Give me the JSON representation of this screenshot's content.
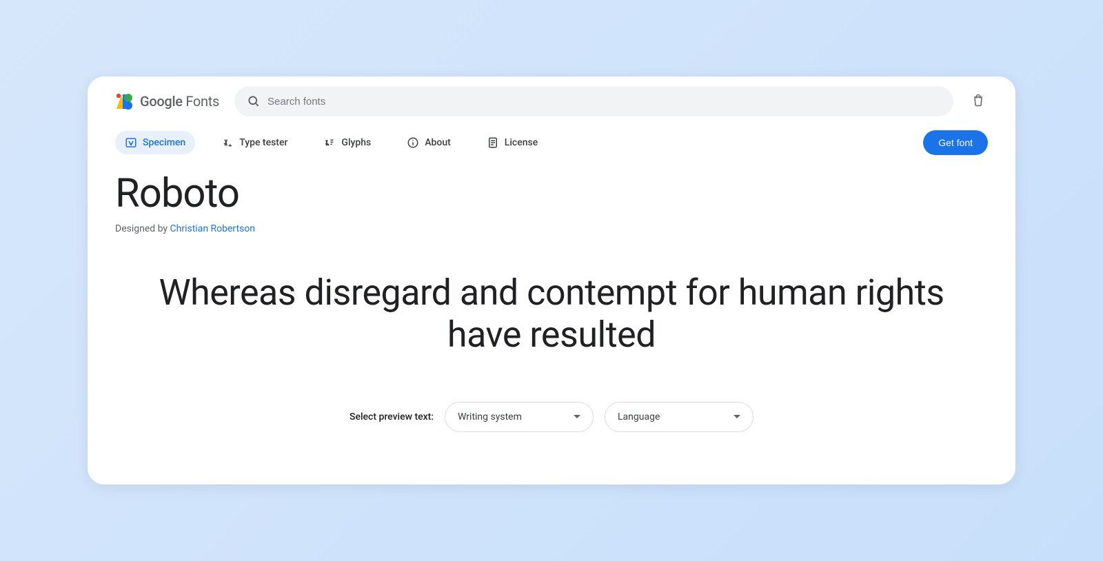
{
  "header": {
    "brand": {
      "strong": "Google",
      "light": "Fonts"
    },
    "search_placeholder": "Search fonts"
  },
  "tabs": {
    "items": [
      {
        "label": "Specimen",
        "active": true
      },
      {
        "label": "Type tester",
        "active": false
      },
      {
        "label": "Glyphs",
        "active": false
      },
      {
        "label": "About",
        "active": false
      },
      {
        "label": "License",
        "active": false
      }
    ],
    "get_font_label": "Get font"
  },
  "title": {
    "name": "Roboto",
    "designed_by_prefix": "Designed by ",
    "designer": "Christian Robertson"
  },
  "preview": {
    "text": "Whereas disregard and contempt for human rights have resulted"
  },
  "controls": {
    "label": "Select preview text:",
    "writing_system": "Writing system",
    "language": "Language"
  }
}
